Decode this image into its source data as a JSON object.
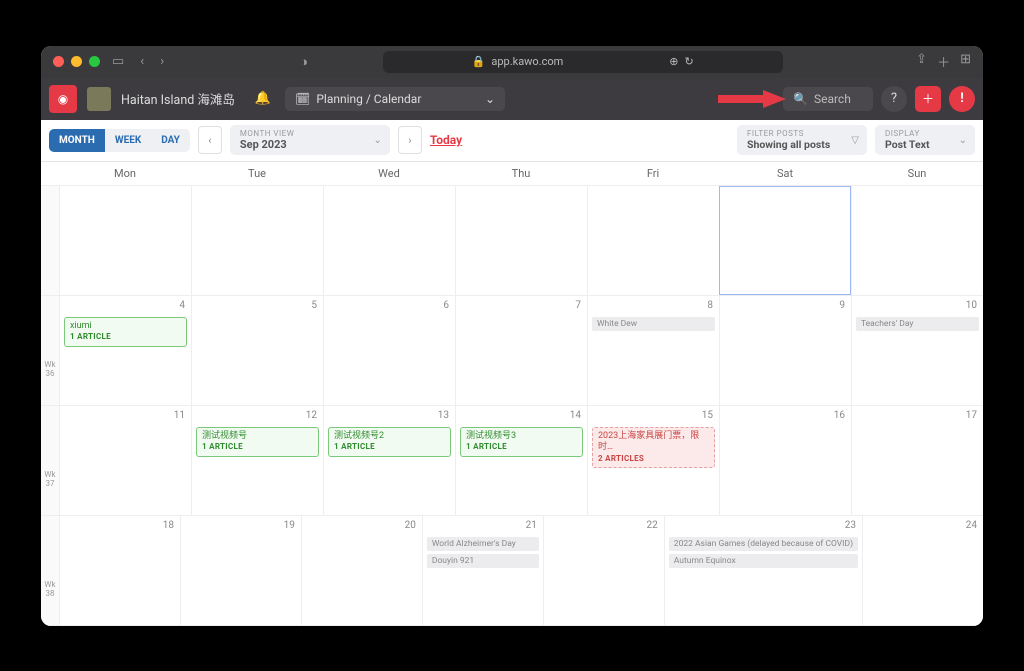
{
  "browser": {
    "url": "app.kawo.com"
  },
  "app": {
    "brand": "Haitan Island 海滩岛",
    "nav": "Planning / Calendar",
    "search_placeholder": "Search"
  },
  "toolbar": {
    "views": {
      "month": "MONTH",
      "week": "WEEK",
      "day": "DAY"
    },
    "period_label": "MONTH VIEW",
    "period_value": "Sep 2023",
    "today": "Today",
    "filter_label": "FILTER POSTS",
    "filter_value": "Showing all posts",
    "display_label": "DISPLAY",
    "display_value": "Post Text"
  },
  "calendar": {
    "day_names": [
      "Mon",
      "Tue",
      "Wed",
      "Thu",
      "Fri",
      "Sat",
      "Sun"
    ],
    "week_labels": [
      "",
      "Wk 36",
      "Wk 37",
      "Wk 38"
    ],
    "rows": [
      [
        {
          "num": ""
        },
        {
          "num": ""
        },
        {
          "num": ""
        },
        {
          "num": ""
        },
        {
          "num": ""
        },
        {
          "num": "",
          "highlight": true
        },
        {
          "num": ""
        }
      ],
      [
        {
          "num": "4",
          "events": [
            {
              "type": "green",
              "title": "xiumi",
              "sub": "1 ARTICLE"
            }
          ]
        },
        {
          "num": "5"
        },
        {
          "num": "6"
        },
        {
          "num": "7"
        },
        {
          "num": "8",
          "events": [
            {
              "type": "gray",
              "title": "White Dew"
            }
          ]
        },
        {
          "num": "9"
        },
        {
          "num": "10",
          "events": [
            {
              "type": "gray",
              "title": "Teachers' Day"
            }
          ]
        }
      ],
      [
        {
          "num": "11"
        },
        {
          "num": "12",
          "events": [
            {
              "type": "green",
              "title": "测试视频号",
              "sub": "1 ARTICLE"
            }
          ]
        },
        {
          "num": "13",
          "events": [
            {
              "type": "green",
              "title": "测试视频号2",
              "sub": "1 ARTICLE"
            }
          ]
        },
        {
          "num": "14",
          "events": [
            {
              "type": "green",
              "title": "测试视频号3",
              "sub": "1 ARTICLE"
            }
          ]
        },
        {
          "num": "15",
          "events": [
            {
              "type": "red",
              "title": "2023上海家具展门票，限时…",
              "sub": "2 ARTICLES"
            }
          ]
        },
        {
          "num": "16"
        },
        {
          "num": "17"
        }
      ],
      [
        {
          "num": "18"
        },
        {
          "num": "19"
        },
        {
          "num": "20"
        },
        {
          "num": "21",
          "events": [
            {
              "type": "gray",
              "title": "World Alzheimer's Day"
            },
            {
              "type": "gray",
              "title": "Douyin 921"
            }
          ]
        },
        {
          "num": "22"
        },
        {
          "num": "23",
          "events": [
            {
              "type": "gray",
              "title": "2022 Asian Games (delayed because of COVID)"
            },
            {
              "type": "gray",
              "title": "Autumn Equinox"
            }
          ]
        },
        {
          "num": "24"
        }
      ]
    ]
  }
}
